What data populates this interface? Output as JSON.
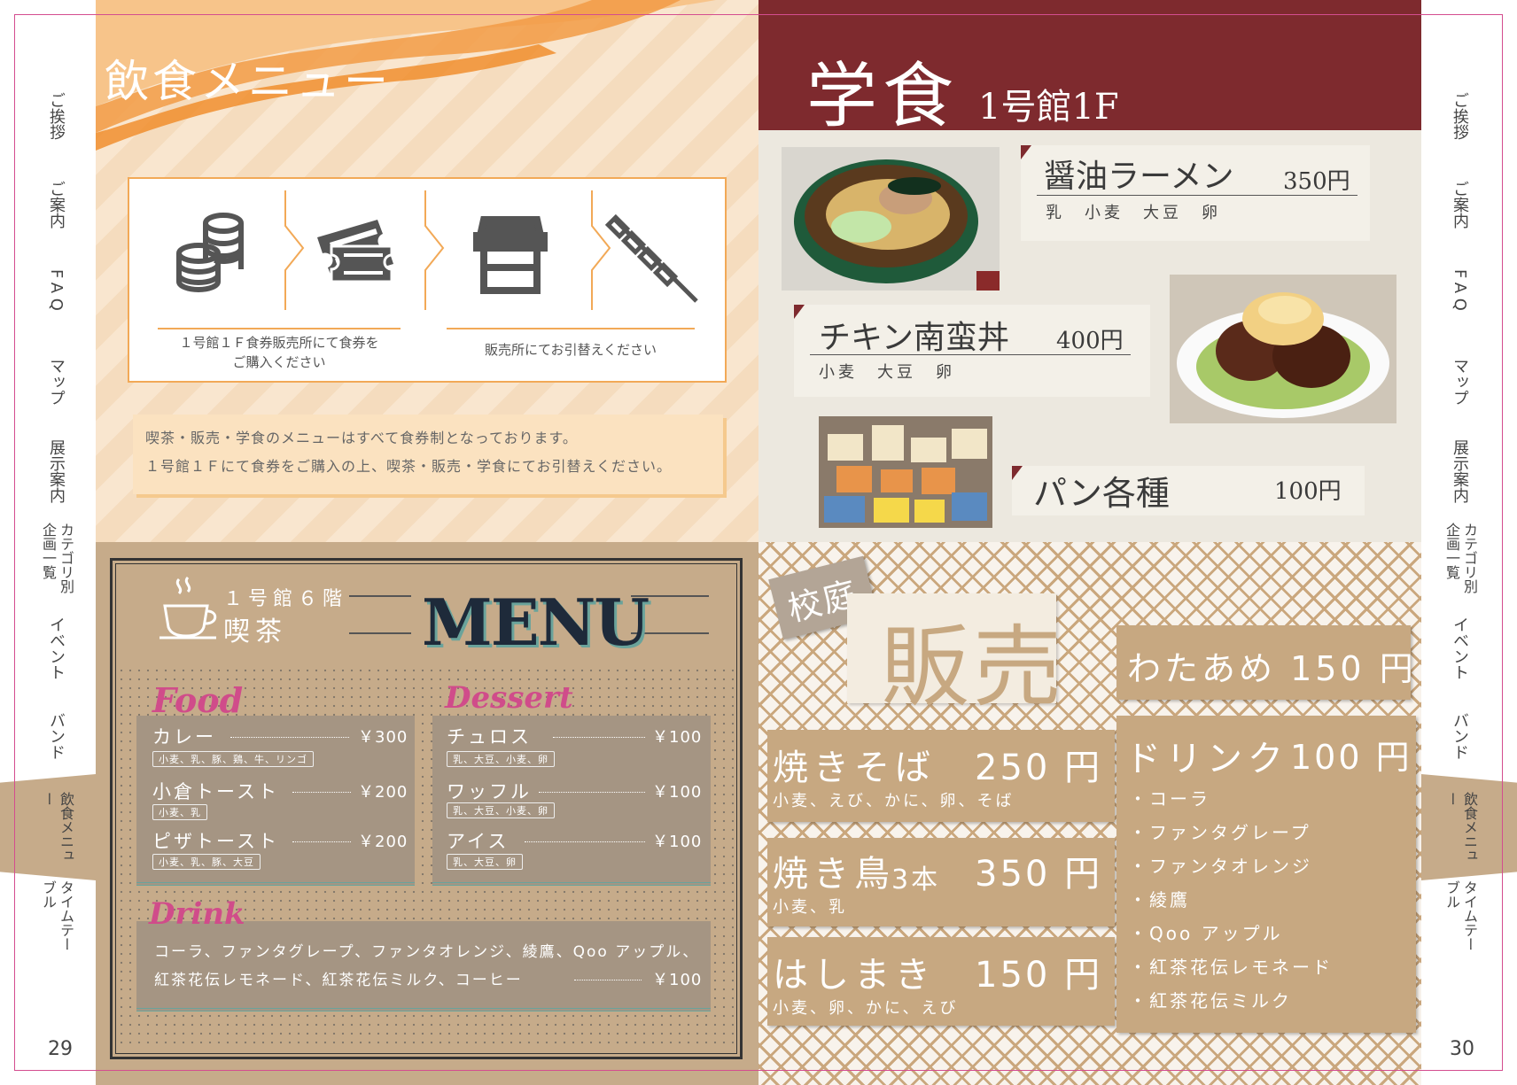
{
  "nav": {
    "items": [
      "ご挨拶",
      "ご案内",
      "FAQ",
      "マップ",
      "展示案内",
      "カテゴリ別企画一覧",
      "イベント",
      "バンド",
      "飲食メニュー",
      "タイムテーブル"
    ],
    "active": "飲食メニュー",
    "page_left": "29",
    "page_right": "30"
  },
  "left_top": {
    "title": "飲食メニュー",
    "step1_caption": "１号館１Ｆ食券販売所にて食券を\nご購入ください",
    "step2_caption": "販売所にてお引替えください",
    "notice_line1": "喫茶・販売・学食のメニューはすべて食券制となっております。",
    "notice_line2": "１号館１Ｆにて食券をご購入の上、喫茶・販売・学食にてお引替えください。",
    "icons": [
      "coins-icon",
      "tickets-icon",
      "stall-icon",
      "skewer-icon"
    ]
  },
  "gakushoku": {
    "title": "学食",
    "location": "1号館1F",
    "items": [
      {
        "name": "醤油ラーメン",
        "price": "350円",
        "allergens": "乳　小麦　大豆　卵"
      },
      {
        "name": "チキン南蛮丼",
        "price": "400円",
        "allergens": "小麦　大豆　卵"
      },
      {
        "name": "パン各種",
        "price": "100円",
        "allergens": ""
      }
    ]
  },
  "kissa": {
    "location": "１号館６階",
    "name": "喫茶",
    "menu_title": "MENU",
    "food_heading": "Food",
    "dessert_heading": "Dessert",
    "drink_heading": "Drink",
    "food": [
      {
        "name": "カレー",
        "price": "￥300",
        "allergy": "小麦、乳、豚、鶏、牛、リンゴ"
      },
      {
        "name": "小倉トースト",
        "price": "￥200",
        "allergy": "小麦、乳"
      },
      {
        "name": "ピザトースト",
        "price": "￥200",
        "allergy": "小麦、乳、豚、大豆"
      }
    ],
    "dessert": [
      {
        "name": "チュロス",
        "price": "￥100",
        "allergy": "乳、大豆、小麦、卵"
      },
      {
        "name": "ワッフル",
        "price": "￥100",
        "allergy": "乳、大豆、小麦、卵"
      },
      {
        "name": "アイス",
        "price": "￥100",
        "allergy": "乳、大豆、卵"
      }
    ],
    "drink_line1": "コーラ、ファンタグレープ、ファンタオレンジ、綾鷹、Qoo アップル、",
    "drink_line2": "紅茶花伝レモネード、紅茶花伝ミルク、コーヒー",
    "drink_price": "￥100"
  },
  "hanbai": {
    "tag": "校庭",
    "title": "販売",
    "stalls": [
      {
        "name": "焼きそば",
        "price": "250 円",
        "sub": "小麦、えび、かに、卵、そば"
      },
      {
        "name": "焼き鳥",
        "qty": "3本",
        "price": "350 円",
        "sub": "小麦、乳"
      },
      {
        "name": "はしまき",
        "price": "150 円",
        "sub": "小麦、卵、かに、えび"
      }
    ],
    "wataame": "わたあめ 150 円",
    "drink_title": "ドリンク",
    "drink_price": "100 円",
    "drinks": [
      "・コーラ",
      "・ファンタグレープ",
      "・ファンタオレンジ",
      "・綾鷹",
      "・Qoo アップル",
      "・紅茶花伝レモネード",
      "・紅茶花伝ミルク"
    ]
  },
  "colors": {
    "maroon": "#7e2a2e",
    "orange": "#f08a24",
    "kraft": "#c6ab8a",
    "pink": "#d44d8f"
  }
}
